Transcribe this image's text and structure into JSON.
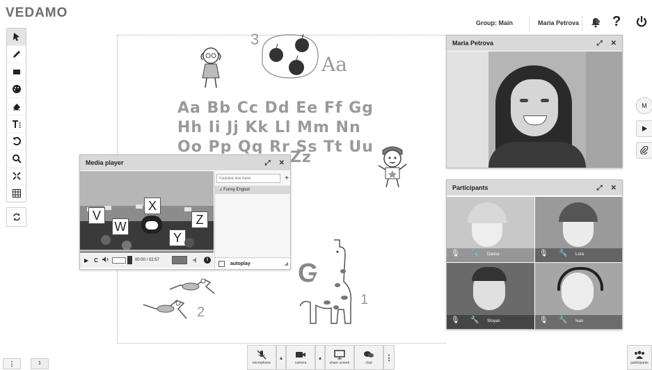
{
  "brand": {
    "logo": "VEDAMO"
  },
  "header": {
    "group_label": "Group: Main",
    "user_name": "Maria Petrova",
    "notify_icon": "bell-icon",
    "help_glyph": "?",
    "power_icon": "power-icon"
  },
  "toolbar": {
    "tools": [
      "pointer-icon",
      "pen-icon",
      "rectangle-icon",
      "palette-icon",
      "eraser-icon",
      "text-icon",
      "undo-icon",
      "zoom-icon",
      "fit-icon",
      "grid-icon"
    ],
    "refresh_icon": "refresh-icon"
  },
  "whiteboard": {
    "number_3": "3",
    "letters_aa": "Aa",
    "alphabet_row1": "Aa Bb Cc Dd Ee Ff Gg",
    "alphabet_row2": "Hh Ii Jj Kk Ll Mm Nn",
    "alphabet_row3": "Oo Pp Qq Rr Ss Tt Uu",
    "alphabet_zz": "Zz",
    "letter_g": "G",
    "number_1": "1",
    "number_2": "2"
  },
  "media_player": {
    "title": "Media player",
    "search_placeholder": "Youtube link here",
    "add_glyph": "+",
    "playlist": [
      "Funny English"
    ],
    "time": "00:00 / 02:57",
    "autoplay_label": "autoplay",
    "video_letters": [
      "V",
      "W",
      "X",
      "Y",
      "Z"
    ],
    "buttons": {
      "play": "▶",
      "repeat": "C",
      "volume": "🔊",
      "fullscreen": "⤢",
      "close": "✕",
      "info": "i"
    }
  },
  "video_window": {
    "title": "Maria Petrova"
  },
  "participants": {
    "title": "Participants",
    "tiles": [
      {
        "name": "Darina"
      },
      {
        "name": "Lora"
      },
      {
        "name": "Stoyan"
      },
      {
        "name": "Ivan"
      }
    ]
  },
  "right_sidebar": {
    "avatar_initial": "M"
  },
  "bottom_bar": {
    "microphone": "microphone",
    "camera": "camera",
    "share_screen": "share screen",
    "chat": "chat",
    "participants": "participants",
    "page_number": "1"
  }
}
